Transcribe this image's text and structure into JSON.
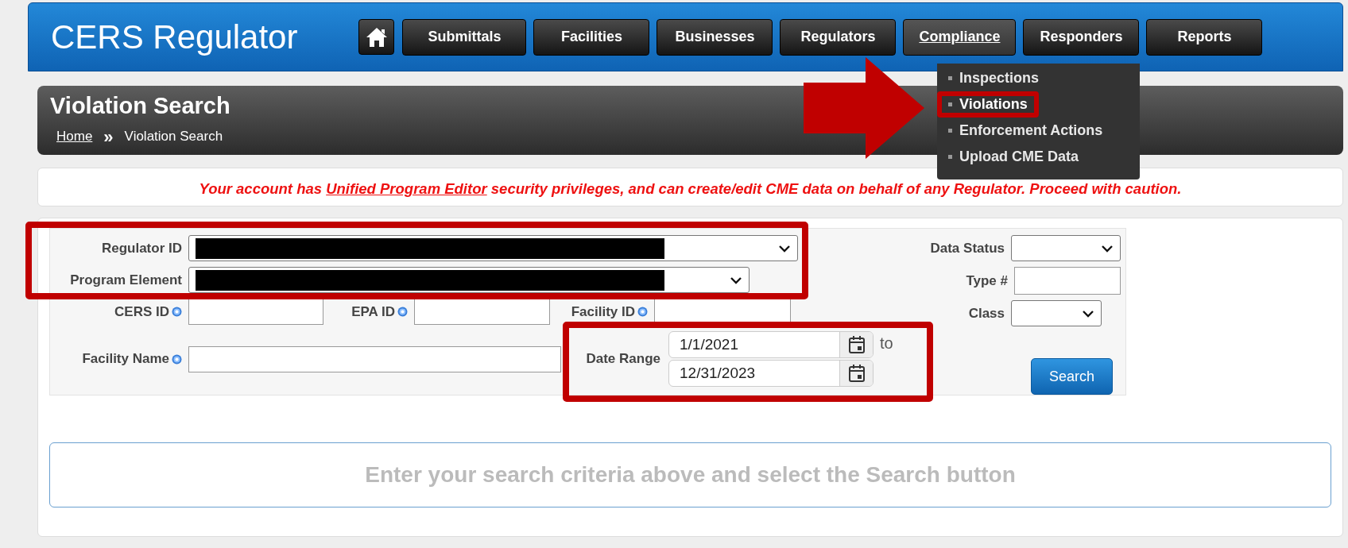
{
  "header": {
    "title": "CERS Regulator",
    "nav": [
      {
        "label": "Submittals",
        "selected": false
      },
      {
        "label": "Facilities",
        "selected": false
      },
      {
        "label": "Businesses",
        "selected": false
      },
      {
        "label": "Regulators",
        "selected": false
      },
      {
        "label": "Compliance",
        "selected": true
      },
      {
        "label": "Responders",
        "selected": false
      },
      {
        "label": "Reports",
        "selected": false
      }
    ]
  },
  "compliance_menu": [
    {
      "label": "Inspections",
      "selected": false
    },
    {
      "label": "Violations",
      "selected": true
    },
    {
      "label": "Enforcement Actions",
      "selected": false
    },
    {
      "label": "Upload CME Data",
      "selected": false
    }
  ],
  "page_title": "Violation Search",
  "breadcrumb": {
    "items": [
      "Home",
      "Violation Search"
    ],
    "separator": "»"
  },
  "notice": {
    "before": "Your account has ",
    "link": "Unified Program Editor",
    "after": " security privileges, and can create/edit CME data on behalf of any Regulator. Proceed with caution."
  },
  "fields": [
    {
      "label": "Regulator ID",
      "kind": "select",
      "help": false,
      "redacted": true
    },
    {
      "label": "Program Element",
      "kind": "select",
      "help": false,
      "redacted": true
    },
    {
      "label": "CERS ID",
      "kind": "text",
      "help": true,
      "redacted": false
    },
    {
      "label": "EPA ID",
      "kind": "text",
      "help": true,
      "redacted": false
    },
    {
      "label": "Facility ID",
      "kind": "text",
      "help": true,
      "redacted": false
    },
    {
      "label": "Facility Name",
      "kind": "text",
      "help": true,
      "redacted": false
    }
  ],
  "date_range": {
    "label": "Date Range",
    "from": "1/1/2021",
    "separator": "to",
    "to": "12/31/2023"
  },
  "right_fields": [
    {
      "label": "Data Status",
      "kind": "select"
    },
    {
      "label": "Type #",
      "kind": "text"
    },
    {
      "label": "Class",
      "kind": "select"
    }
  ],
  "search_button": "Search",
  "results_message": "Enter your search criteria above and select the Search button"
}
